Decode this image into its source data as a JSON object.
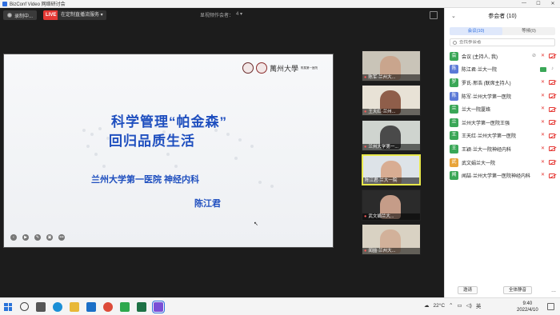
{
  "window": {
    "title": "BizConf Video 网络研讨会",
    "controls": [
      "—",
      "☐",
      "✕"
    ]
  },
  "toolbar": {
    "record_label": "录制中...",
    "live_badge": "LIVE",
    "live_service": "在定制直播流服务 ▾",
    "sharer_label": "显视频作会者：",
    "sharer_name": "4 ▾"
  },
  "slide": {
    "logo_text": "萬州大學",
    "logo_sub": "附属第一医院",
    "title_line1": "科学管理“帕金森”",
    "title_line2": "回归品质生活",
    "hospital": "兰州大学第一医院   神经内科",
    "speaker": "陈江君",
    "controls": [
      "‹",
      "▶",
      "✎",
      "▣",
      "•••"
    ]
  },
  "video_tiles": [
    {
      "label": "陈军·兰州大...",
      "bg": "#c9c4b8",
      "skin": "#c9a58d",
      "muted": true
    },
    {
      "label": "王天红·兰州...",
      "bg": "#e8e2d6",
      "skin": "#8f5e4a",
      "muted": true
    },
    {
      "label": "兰州大学第一...",
      "bg": "#cfd4cf",
      "skin": "#4a4a4a",
      "muted": true
    },
    {
      "label": "陈江君·兰大一院",
      "bg": "#dde3e8",
      "skin": "#d8ad93",
      "muted": false,
      "active": true
    },
    {
      "label": "武文娟兰大...",
      "bg": "#2b2b2b",
      "skin": "#c59c88",
      "muted": true
    },
    {
      "label": "闻喆·兰州大...",
      "bg": "#d9d2c3",
      "skin": "#d2b19a",
      "muted": true
    }
  ],
  "panel": {
    "title": "参会者 (10)",
    "tab_inmeeting": "会议(10)",
    "tab_waiting": "等候(0)",
    "search_placeholder": "查找参会者",
    "invite_label": "邀请",
    "mute_all_label": "全体静音",
    "more_label": "...",
    "participants": [
      {
        "initial": "会",
        "name": "会议 (主持人, 我)",
        "color": "#3aa757",
        "icons": [
          "gray-circle",
          "mic-off",
          "vid-off"
        ]
      },
      {
        "initial": "陈",
        "name": "陈江君·兰大一院",
        "color": "#5b79d6",
        "icons": [
          "vid-on",
          "mic-on-gray"
        ]
      },
      {
        "initial": "罗",
        "name": "罗氏·邢浩 (联席主持人)",
        "color": "#3aa757",
        "icons": [
          "mic-off",
          "vid-off"
        ]
      },
      {
        "initial": "陈",
        "name": "陈军·兰州大学第一医院",
        "color": "#5b79d6",
        "icons": [
          "mic-off",
          "vid-off"
        ]
      },
      {
        "initial": "兰",
        "name": "兰大一院厦络",
        "color": "#3aa757",
        "icons": [
          "mic-off",
          "vid-off"
        ]
      },
      {
        "initial": "兰",
        "name": "兰州大学第一医院王强",
        "color": "#3aa757",
        "icons": [
          "mic-off",
          "vid-off"
        ]
      },
      {
        "initial": "王",
        "name": "王天红·兰州大学第一医院",
        "color": "#3aa757",
        "icons": [
          "mic-off",
          "vid-off"
        ]
      },
      {
        "initial": "王",
        "name": "王颖·兰大一院神经内科",
        "color": "#3aa757",
        "icons": [
          "mic-off",
          "vid-off"
        ]
      },
      {
        "initial": "武",
        "name": "武文娟兰大一院",
        "color": "#e8a43a",
        "icons": [
          "mic-off",
          "vid-off"
        ]
      },
      {
        "initial": "闻",
        "name": "闻喆·兰州大学第一医院神经内科",
        "color": "#3aa757",
        "icons": [
          "mic-off",
          "vid-off"
        ]
      }
    ]
  },
  "taskbar": {
    "apps": [
      {
        "name": "task-view",
        "color": "#555555"
      },
      {
        "name": "edge",
        "color": "#1a8fd6"
      },
      {
        "name": "file-explorer",
        "color": "#e8b838"
      },
      {
        "name": "outlook",
        "color": "#1b6fc7"
      },
      {
        "name": "chrome",
        "color": "#dd4b39"
      },
      {
        "name": "wechat",
        "color": "#2ea84d"
      },
      {
        "name": "excel",
        "color": "#1e7145"
      },
      {
        "name": "bizconf",
        "color": "#7a4fd6"
      }
    ],
    "temperature": "22°C",
    "input_method": "英",
    "time": "9:40",
    "date": "2022/4/10"
  }
}
